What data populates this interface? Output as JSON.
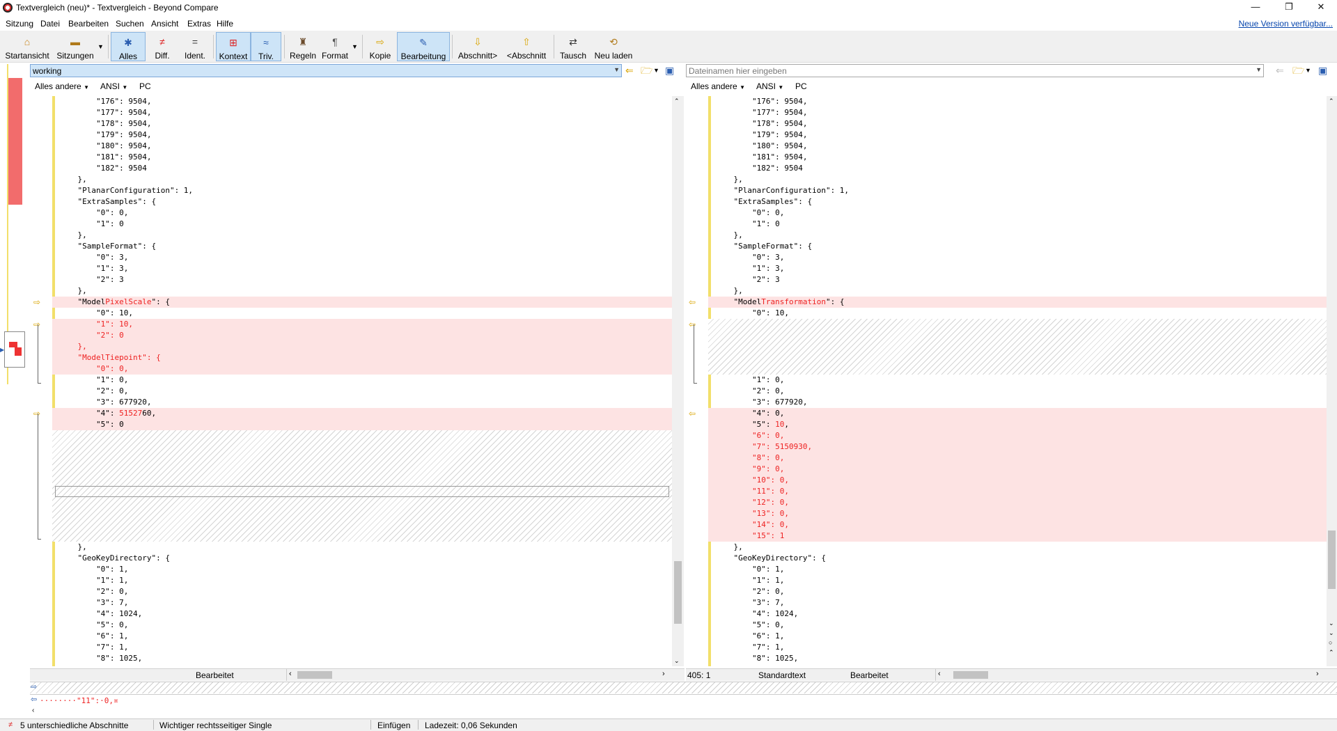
{
  "window": {
    "title": "Textvergleich (neu)* - Textvergleich - Beyond Compare",
    "minimize": "—",
    "restore": "❐",
    "close": "✕"
  },
  "menu": {
    "items": [
      "Sitzung",
      "Datei",
      "Bearbeiten",
      "Suchen",
      "Ansicht",
      "Extras",
      "Hilfe"
    ],
    "update_link": "Neue Version verfügbar..."
  },
  "toolbar": {
    "buttons": [
      {
        "label": "Startansicht",
        "icon": "home-icon"
      },
      {
        "label": "Sitzungen",
        "icon": "sessions-icon"
      },
      {
        "label": "Alles",
        "icon": "all-icon",
        "active": true
      },
      {
        "label": "Diff.",
        "icon": "diff-icon"
      },
      {
        "label": "Ident.",
        "icon": "ident-icon"
      },
      {
        "label": "Kontext",
        "icon": "context-icon",
        "active": true
      },
      {
        "label": "Triv.",
        "icon": "trivial-icon",
        "active": true
      },
      {
        "label": "Regeln",
        "icon": "rules-icon"
      },
      {
        "label": "Format",
        "icon": "format-icon"
      },
      {
        "label": "Kopie",
        "icon": "copy-icon"
      },
      {
        "label": "Bearbeitung",
        "icon": "edit-icon",
        "active": true
      },
      {
        "label": "Abschnitt>",
        "icon": "next-section-icon"
      },
      {
        "label": "<Abschnitt",
        "icon": "prev-section-icon"
      },
      {
        "label": "Tausch",
        "icon": "swap-icon"
      },
      {
        "label": "Neu laden",
        "icon": "reload-icon"
      }
    ]
  },
  "left": {
    "path": "working",
    "options": [
      "Alles andere",
      "ANSI",
      "PC"
    ],
    "status_label": "Bearbeitet"
  },
  "right": {
    "path_placeholder": "Dateinamen hier eingeben",
    "options": [
      "Alles andere",
      "ANSI",
      "PC"
    ],
    "position": "405: 1",
    "format_label": "Standardtext",
    "status_label": "Bearbeitet"
  },
  "left_lines": [
    {
      "row": 0,
      "text": "        \"176\": 9504,"
    },
    {
      "row": 1,
      "text": "        \"177\": 9504,"
    },
    {
      "row": 2,
      "text": "        \"178\": 9504,"
    },
    {
      "row": 3,
      "text": "        \"179\": 9504,"
    },
    {
      "row": 4,
      "text": "        \"180\": 9504,"
    },
    {
      "row": 5,
      "text": "        \"181\": 9504,"
    },
    {
      "row": 6,
      "text": "        \"182\": 9504"
    },
    {
      "row": 7,
      "text": "    },"
    },
    {
      "row": 8,
      "text": "    \"PlanarConfiguration\": 1,"
    },
    {
      "row": 9,
      "text": "    \"ExtraSamples\": {"
    },
    {
      "row": 10,
      "text": "        \"0\": 0,"
    },
    {
      "row": 11,
      "text": "        \"1\": 0"
    },
    {
      "row": 12,
      "text": "    },"
    },
    {
      "row": 13,
      "text": "    \"SampleFormat\": {"
    },
    {
      "row": 14,
      "text": "        \"0\": 3,"
    },
    {
      "row": 15,
      "text": "        \"1\": 3,"
    },
    {
      "row": 16,
      "text": "        \"2\": 3"
    },
    {
      "row": 17,
      "text": "    },"
    },
    {
      "row": 18,
      "diff": true,
      "parts": [
        [
          "    \"Model",
          ""
        ],
        [
          "PixelScale",
          "red"
        ],
        [
          "\": {",
          ""
        ]
      ]
    },
    {
      "row": 19,
      "text": "        \"0\": 10,"
    },
    {
      "row": 20,
      "diff": true,
      "parts": [
        [
          "        \"1\": 10,",
          "red"
        ]
      ]
    },
    {
      "row": 21,
      "diff": true,
      "parts": [
        [
          "        \"2\": 0",
          "red"
        ]
      ]
    },
    {
      "row": 22,
      "diff": true,
      "parts": [
        [
          "    },",
          "red"
        ]
      ]
    },
    {
      "row": 23,
      "diff": true,
      "parts": [
        [
          "    \"ModelTiepoint\": {",
          "red"
        ]
      ]
    },
    {
      "row": 24,
      "diff": true,
      "parts": [
        [
          "        \"0\": 0,",
          "red"
        ]
      ]
    },
    {
      "row": 25,
      "text": "        \"1\": 0,"
    },
    {
      "row": 26,
      "text": "        \"2\": 0,"
    },
    {
      "row": 27,
      "text": "        \"3\": 677920,"
    },
    {
      "row": 28,
      "diff": true,
      "parts": [
        [
          "        \"4\": ",
          ""
        ],
        [
          "51527",
          "red"
        ],
        [
          "60,",
          ""
        ]
      ]
    },
    {
      "row": 29,
      "diff": true,
      "parts": [
        [
          "        \"5\": 0",
          ""
        ]
      ]
    },
    {
      "row": 40,
      "text": "    },"
    },
    {
      "row": 41,
      "text": "    \"GeoKeyDirectory\": {"
    },
    {
      "row": 42,
      "text": "        \"0\": 1,"
    },
    {
      "row": 43,
      "text": "        \"1\": 1,"
    },
    {
      "row": 44,
      "text": "        \"2\": 0,"
    },
    {
      "row": 45,
      "text": "        \"3\": 7,"
    },
    {
      "row": 46,
      "text": "        \"4\": 1024,"
    },
    {
      "row": 47,
      "text": "        \"5\": 0,"
    },
    {
      "row": 48,
      "text": "        \"6\": 1,"
    },
    {
      "row": 49,
      "text": "        \"7\": 1,"
    },
    {
      "row": 50,
      "text": "        \"8\": 1025,"
    }
  ],
  "right_lines": [
    {
      "row": 0,
      "text": "        \"176\": 9504,"
    },
    {
      "row": 1,
      "text": "        \"177\": 9504,"
    },
    {
      "row": 2,
      "text": "        \"178\": 9504,"
    },
    {
      "row": 3,
      "text": "        \"179\": 9504,"
    },
    {
      "row": 4,
      "text": "        \"180\": 9504,"
    },
    {
      "row": 5,
      "text": "        \"181\": 9504,"
    },
    {
      "row": 6,
      "text": "        \"182\": 9504"
    },
    {
      "row": 7,
      "text": "    },"
    },
    {
      "row": 8,
      "text": "    \"PlanarConfiguration\": 1,"
    },
    {
      "row": 9,
      "text": "    \"ExtraSamples\": {"
    },
    {
      "row": 10,
      "text": "        \"0\": 0,"
    },
    {
      "row": 11,
      "text": "        \"1\": 0"
    },
    {
      "row": 12,
      "text": "    },"
    },
    {
      "row": 13,
      "text": "    \"SampleFormat\": {"
    },
    {
      "row": 14,
      "text": "        \"0\": 3,"
    },
    {
      "row": 15,
      "text": "        \"1\": 3,"
    },
    {
      "row": 16,
      "text": "        \"2\": 3"
    },
    {
      "row": 17,
      "text": "    },"
    },
    {
      "row": 18,
      "diff": true,
      "parts": [
        [
          "    \"Model",
          ""
        ],
        [
          "Transformation",
          "red"
        ],
        [
          "\": {",
          ""
        ]
      ]
    },
    {
      "row": 19,
      "text": "        \"0\": 10,"
    },
    {
      "row": 25,
      "text": "        \"1\": 0,"
    },
    {
      "row": 26,
      "text": "        \"2\": 0,"
    },
    {
      "row": 27,
      "text": "        \"3\": 677920,"
    },
    {
      "row": 28,
      "diff": true,
      "parts": [
        [
          "        \"4\": 0,",
          ""
        ]
      ]
    },
    {
      "row": 29,
      "diff": true,
      "parts": [
        [
          "        \"5\": ",
          ""
        ],
        [
          "10",
          "red"
        ],
        [
          ",",
          ""
        ]
      ]
    },
    {
      "row": 30,
      "diff": true,
      "parts": [
        [
          "        \"6\": 0,",
          "red"
        ]
      ]
    },
    {
      "row": 31,
      "diff": true,
      "parts": [
        [
          "        \"7\": 5150930,",
          "red"
        ]
      ]
    },
    {
      "row": 32,
      "diff": true,
      "parts": [
        [
          "        \"8\": 0,",
          "red"
        ]
      ]
    },
    {
      "row": 33,
      "diff": true,
      "parts": [
        [
          "        \"9\": 0,",
          "red"
        ]
      ]
    },
    {
      "row": 34,
      "diff": true,
      "parts": [
        [
          "        \"10\": 0,",
          "red"
        ]
      ]
    },
    {
      "row": 35,
      "diff": true,
      "parts": [
        [
          "        \"11\": 0,",
          "red"
        ]
      ]
    },
    {
      "row": 36,
      "diff": true,
      "parts": [
        [
          "        \"12\": 0,",
          "red"
        ]
      ]
    },
    {
      "row": 37,
      "diff": true,
      "parts": [
        [
          "        \"13\": 0,",
          "red"
        ]
      ]
    },
    {
      "row": 38,
      "diff": true,
      "parts": [
        [
          "        \"14\": 0,",
          "red"
        ]
      ]
    },
    {
      "row": 39,
      "diff": true,
      "parts": [
        [
          "        \"15\": 1",
          "red"
        ]
      ]
    },
    {
      "row": 40,
      "text": "    },"
    },
    {
      "row": 41,
      "text": "    \"GeoKeyDirectory\": {"
    },
    {
      "row": 42,
      "text": "        \"0\": 1,"
    },
    {
      "row": 43,
      "text": "        \"1\": 1,"
    },
    {
      "row": 44,
      "text": "        \"2\": 0,"
    },
    {
      "row": 45,
      "text": "        \"3\": 7,"
    },
    {
      "row": 46,
      "text": "        \"4\": 1024,"
    },
    {
      "row": 47,
      "text": "        \"5\": 0,"
    },
    {
      "row": 48,
      "text": "        \"6\": 1,"
    },
    {
      "row": 49,
      "text": "        \"7\": 1,"
    },
    {
      "row": 50,
      "text": "        \"8\": 1025,"
    }
  ],
  "detail_line": "········\"11\":·0,¤",
  "statusbar": {
    "sections": "5 unterschiedliche Abschnitte",
    "important": "Wichtiger rechtsseitiger Single",
    "mode": "Einfügen",
    "load_time": "Ladezeit: 0,06 Sekunden"
  },
  "colors": {
    "diff_bg": "#fde3e3",
    "diff_text": "#e22222",
    "accent": "#0645ad",
    "change_bar": "#f2df6a"
  }
}
